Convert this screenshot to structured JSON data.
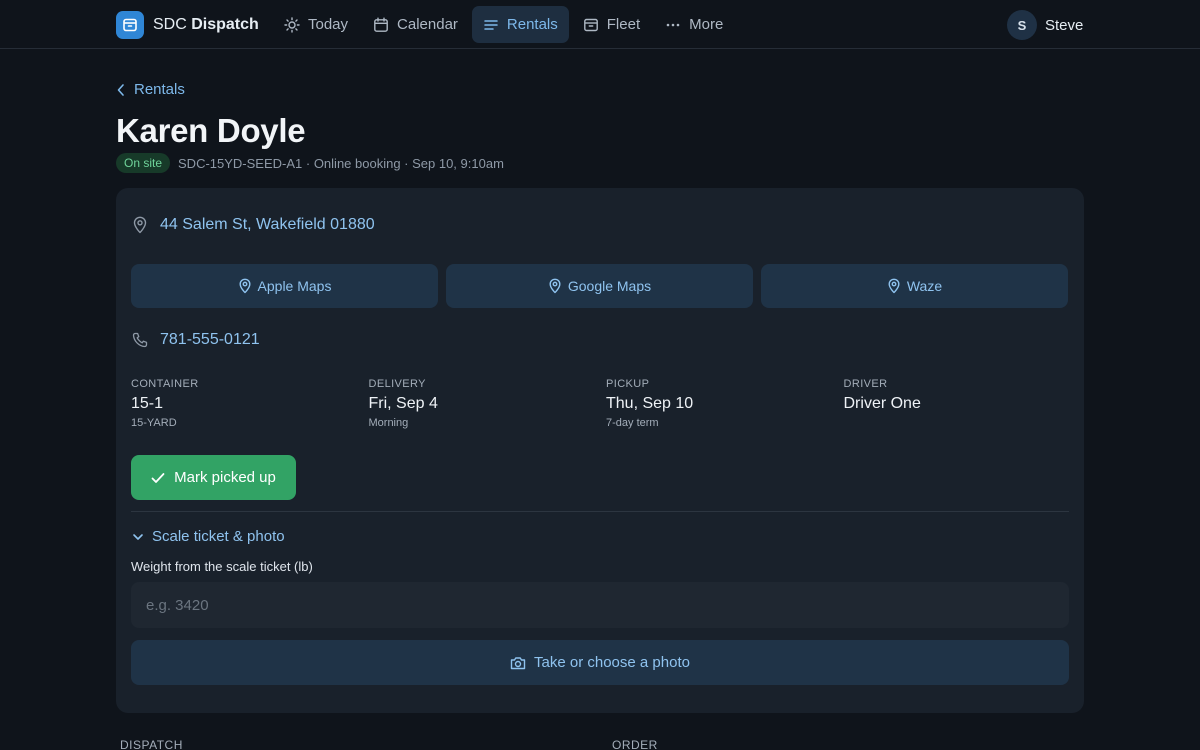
{
  "app": {
    "brand_prefix": "SDC",
    "brand_name": "Dispatch"
  },
  "nav": {
    "items": [
      {
        "label": "Today",
        "icon": "sun-icon"
      },
      {
        "label": "Calendar",
        "icon": "calendar-icon"
      },
      {
        "label": "Rentals",
        "icon": "list-icon",
        "active": true
      },
      {
        "label": "Fleet",
        "icon": "box-icon"
      },
      {
        "label": "More",
        "icon": "ellipsis-icon"
      }
    ]
  },
  "user": {
    "initial": "S",
    "name": "Steve"
  },
  "breadcrumb": {
    "back_label": "Rentals"
  },
  "customer": {
    "name": "Karen Doyle",
    "status": "On site",
    "meta": "SDC-15YD-SEED-A1 · Online booking · Sep 10, 9:10am"
  },
  "location": {
    "address": "44 Salem St, Wakefield 01880",
    "maps": [
      "Apple Maps",
      "Google Maps",
      "Waze"
    ],
    "phone": "781-555-0121"
  },
  "details": {
    "container": {
      "label": "CONTAINER",
      "value": "15-1",
      "sub": "15-YARD"
    },
    "delivery": {
      "label": "DELIVERY",
      "value": "Fri, Sep 4",
      "sub": "Morning"
    },
    "pickup": {
      "label": "PICKUP",
      "value": "Thu, Sep 10",
      "sub": "7-day term"
    },
    "driver": {
      "label": "DRIVER",
      "value": "Driver One",
      "sub": ""
    }
  },
  "actions": {
    "mark_picked_up": "Mark picked up",
    "scale_toggle": "Scale ticket & photo",
    "weight_label": "Weight from the scale ticket (lb)",
    "weight_placeholder": "e.g. 3420",
    "weight_value": "",
    "photo_button": "Take or choose a photo"
  },
  "sections": {
    "dispatch": "DISPATCH",
    "order": "ORDER"
  },
  "colors": {
    "background": "#0f141b",
    "card": "#19212b",
    "accent": "#7db8ea",
    "success": "#32a365",
    "badge_bg": "#173a29",
    "badge_text": "#6fd39a"
  }
}
